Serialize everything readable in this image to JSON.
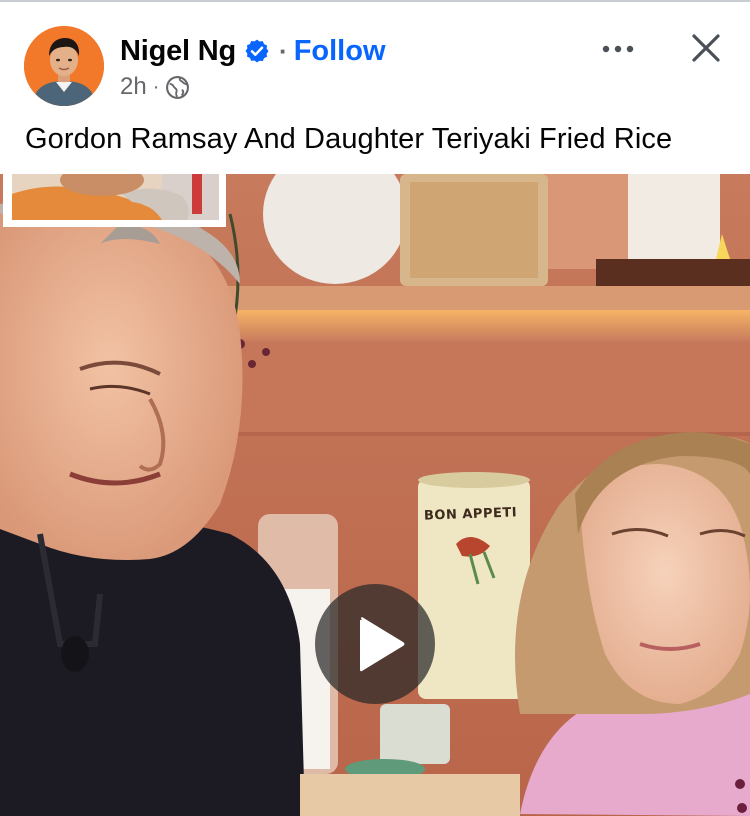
{
  "post": {
    "author_name": "Nigel Ng",
    "separator": "·",
    "follow_label": "Follow",
    "timestamp": "2h",
    "meta_separator": "·",
    "audience_icon": "globe-icon",
    "verified_icon": "verified-badge-icon",
    "caption": "Gordon Ramsay And Daughter Teriyaki Fried Rice",
    "more_icon": "more-options-icon",
    "close_icon": "close-icon"
  },
  "video": {
    "jar_label": "BON APPETI",
    "play_icon": "play-icon"
  },
  "colors": {
    "link_blue": "#0866ff",
    "verified_blue": "#0866ff",
    "text_primary": "#050505",
    "text_secondary": "#65676b",
    "avatar_background": "#f2792a"
  }
}
